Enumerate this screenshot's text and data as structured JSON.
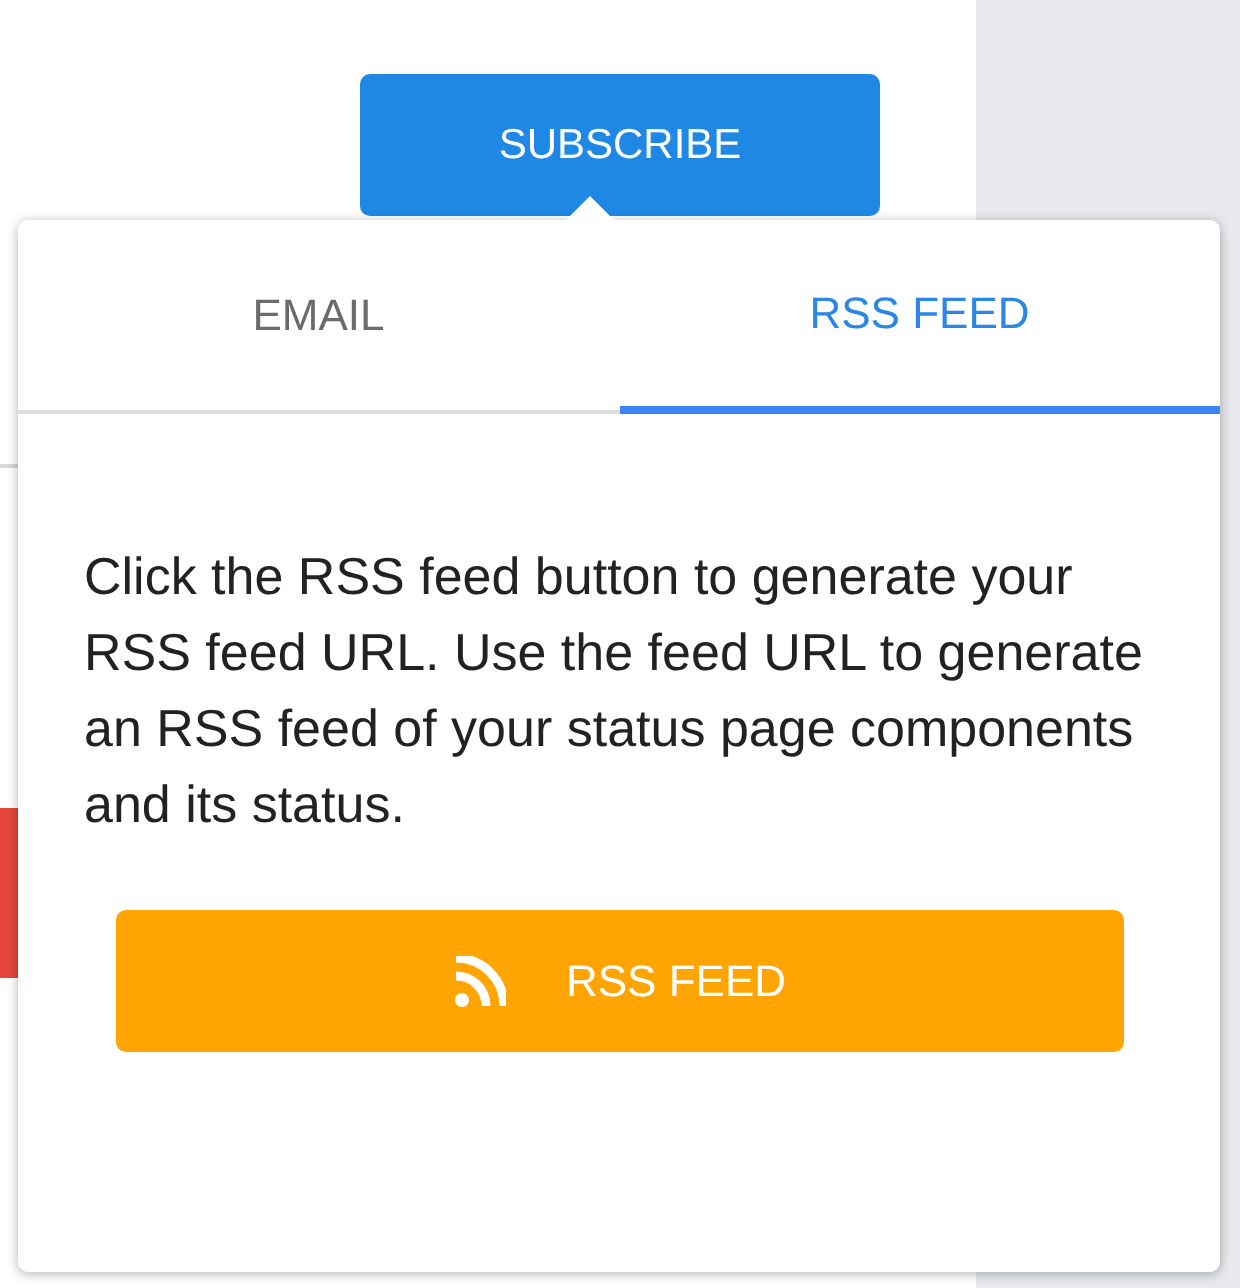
{
  "subscribe_button": {
    "label": "SUBSCRIBE"
  },
  "popover": {
    "tabs": [
      {
        "label": "EMAIL",
        "selected": false
      },
      {
        "label": "RSS FEED",
        "selected": true
      }
    ],
    "description": "Click the RSS feed button to generate your RSS feed URL. Use the feed URL to generate an RSS feed of your status page components and its status.",
    "action_button": {
      "label": "RSS FEED"
    }
  }
}
